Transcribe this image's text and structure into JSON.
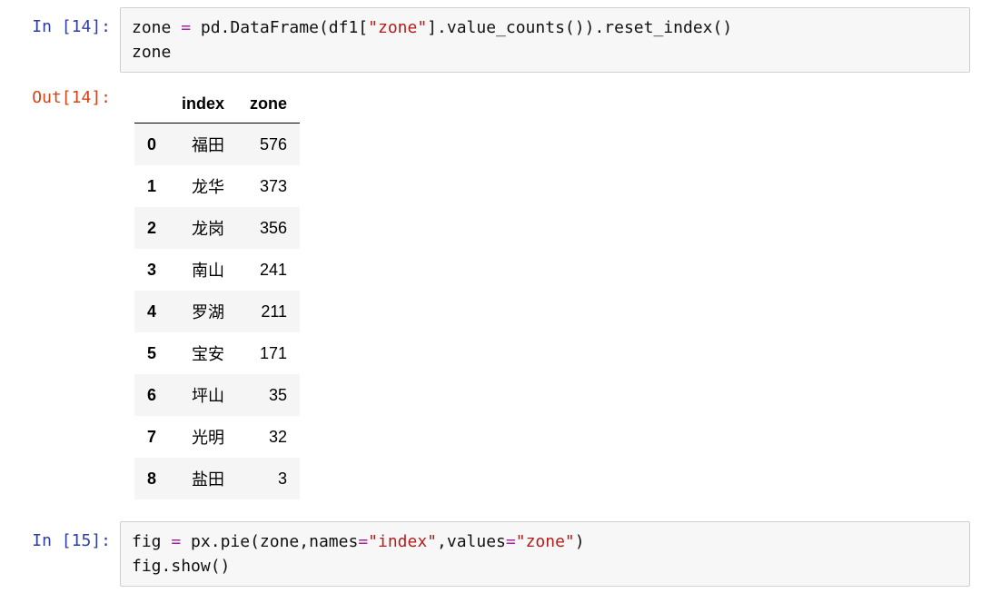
{
  "cells": {
    "in14": {
      "prompt_prefix": "In [",
      "prompt_num": "14",
      "prompt_suffix": "]:",
      "code_tokens": [
        {
          "t": "zone ",
          "c": "t-name"
        },
        {
          "t": "=",
          "c": "t-op"
        },
        {
          "t": " pd",
          "c": "t-name"
        },
        {
          "t": ".",
          "c": "t-punc"
        },
        {
          "t": "DataFrame",
          "c": "t-call"
        },
        {
          "t": "(",
          "c": "t-punc"
        },
        {
          "t": "df1",
          "c": "t-name"
        },
        {
          "t": "[",
          "c": "t-punc"
        },
        {
          "t": "\"zone\"",
          "c": "t-str"
        },
        {
          "t": "]",
          "c": "t-punc"
        },
        {
          "t": ".",
          "c": "t-punc"
        },
        {
          "t": "value_counts",
          "c": "t-call"
        },
        {
          "t": "()",
          "c": "t-punc"
        },
        {
          "t": ")",
          "c": "t-punc"
        },
        {
          "t": ".",
          "c": "t-punc"
        },
        {
          "t": "reset_index",
          "c": "t-call"
        },
        {
          "t": "()",
          "c": "t-punc"
        },
        {
          "t": "\n",
          "c": ""
        },
        {
          "t": "zone",
          "c": "t-name"
        }
      ]
    },
    "out14": {
      "prompt_prefix": "Out[",
      "prompt_num": "14",
      "prompt_suffix": "]:",
      "columns": [
        "index",
        "zone"
      ],
      "rows": [
        {
          "i": "0",
          "index": "福田",
          "zone": "576"
        },
        {
          "i": "1",
          "index": "龙华",
          "zone": "373"
        },
        {
          "i": "2",
          "index": "龙岗",
          "zone": "356"
        },
        {
          "i": "3",
          "index": "南山",
          "zone": "241"
        },
        {
          "i": "4",
          "index": "罗湖",
          "zone": "211"
        },
        {
          "i": "5",
          "index": "宝安",
          "zone": "171"
        },
        {
          "i": "6",
          "index": "坪山",
          "zone": "35"
        },
        {
          "i": "7",
          "index": "光明",
          "zone": "32"
        },
        {
          "i": "8",
          "index": "盐田",
          "zone": "3"
        }
      ]
    },
    "in15": {
      "prompt_prefix": "In [",
      "prompt_num": "15",
      "prompt_suffix": "]:",
      "code_tokens": [
        {
          "t": "fig ",
          "c": "t-name"
        },
        {
          "t": "=",
          "c": "t-op"
        },
        {
          "t": " px",
          "c": "t-name"
        },
        {
          "t": ".",
          "c": "t-punc"
        },
        {
          "t": "pie",
          "c": "t-call"
        },
        {
          "t": "(",
          "c": "t-punc"
        },
        {
          "t": "zone",
          "c": "t-name"
        },
        {
          "t": ",",
          "c": "t-punc"
        },
        {
          "t": "names",
          "c": "t-name"
        },
        {
          "t": "=",
          "c": "t-op"
        },
        {
          "t": "\"index\"",
          "c": "t-str"
        },
        {
          "t": ",",
          "c": "t-punc"
        },
        {
          "t": "values",
          "c": "t-name"
        },
        {
          "t": "=",
          "c": "t-op"
        },
        {
          "t": "\"zone\"",
          "c": "t-str"
        },
        {
          "t": ")",
          "c": "t-punc"
        },
        {
          "t": "\n",
          "c": ""
        },
        {
          "t": "fig",
          "c": "t-name"
        },
        {
          "t": ".",
          "c": "t-punc"
        },
        {
          "t": "show",
          "c": "t-call"
        },
        {
          "t": "()",
          "c": "t-punc"
        }
      ]
    }
  }
}
